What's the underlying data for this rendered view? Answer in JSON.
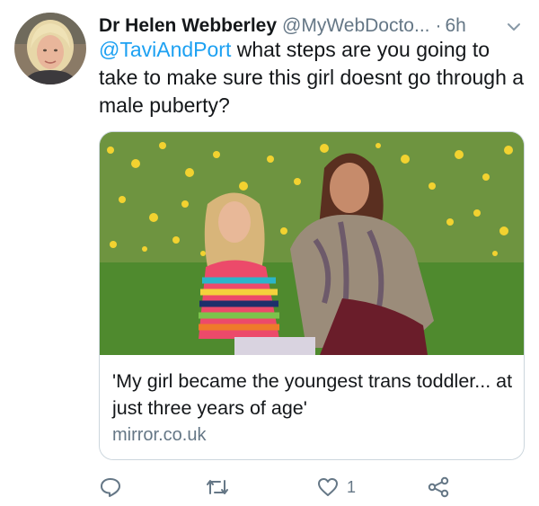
{
  "tweet": {
    "display_name": "Dr Helen Webberley",
    "handle": "@MyWebDocto...",
    "separator": "·",
    "time": "6h",
    "mention": "@TaviAndPort",
    "text": " what steps are you going to take to make sure this girl doesnt go through a male puberty?"
  },
  "card": {
    "title": "'My girl became the youngest trans toddler... at just three years of age'",
    "domain": "mirror.co.uk"
  },
  "actions": {
    "reply_icon": "reply-icon",
    "retweet_icon": "retweet-icon",
    "like_icon": "heart-icon",
    "like_count": "1",
    "share_icon": "share-icon"
  },
  "colors": {
    "link": "#1da1f2",
    "secondary_text": "#657786",
    "border": "#ccd6dd"
  }
}
